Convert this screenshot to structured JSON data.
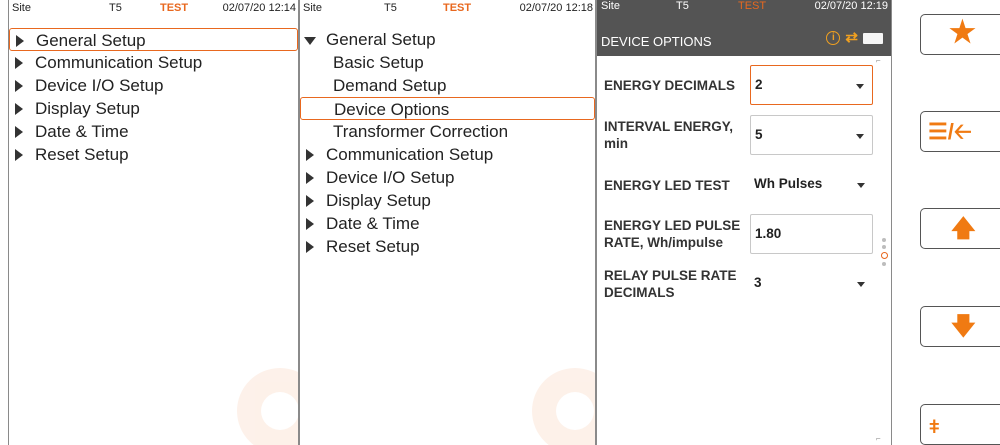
{
  "status": {
    "site": "Site",
    "device": "T5",
    "mode": "TEST"
  },
  "screen1": {
    "time": "02/07/20 12:14",
    "menu": [
      {
        "label": "General Setup"
      },
      {
        "label": "Communication Setup"
      },
      {
        "label": "Device I/O Setup"
      },
      {
        "label": "Display Setup"
      },
      {
        "label": "Date & Time"
      },
      {
        "label": "Reset Setup"
      }
    ]
  },
  "screen2": {
    "time": "02/07/20 12:18",
    "menu": [
      {
        "label": "General Setup"
      },
      {
        "label": "Basic Setup"
      },
      {
        "label": "Demand Setup"
      },
      {
        "label": "Device Options"
      },
      {
        "label": "Transformer Correction"
      },
      {
        "label": "Communication Setup"
      },
      {
        "label": "Device I/O Setup"
      },
      {
        "label": "Display Setup"
      },
      {
        "label": "Date & Time"
      },
      {
        "label": "Reset Setup"
      }
    ]
  },
  "screen3": {
    "time": "02/07/20 12:19",
    "title": "DEVICE OPTIONS",
    "fields": [
      {
        "label": "ENERGY DECIMALS",
        "value": "2"
      },
      {
        "label": "INTERVAL ENERGY, min",
        "value": "5"
      },
      {
        "label": "ENERGY LED TEST",
        "value": "Wh Pulses"
      },
      {
        "label": "ENERGY LED PULSE RATE, Wh/impulse",
        "value": "1.80"
      },
      {
        "label": "RELAY PULSE RATE DECIMALS",
        "value": "3"
      }
    ]
  },
  "side_buttons": {
    "favorites": "★",
    "back": "☰/🡠",
    "up": "🡅",
    "down": "🡇",
    "dev": "ǂ"
  },
  "colors": {
    "accent": "#e8681f",
    "header_bg": "#545454",
    "icon_orange": "#f07a12"
  }
}
